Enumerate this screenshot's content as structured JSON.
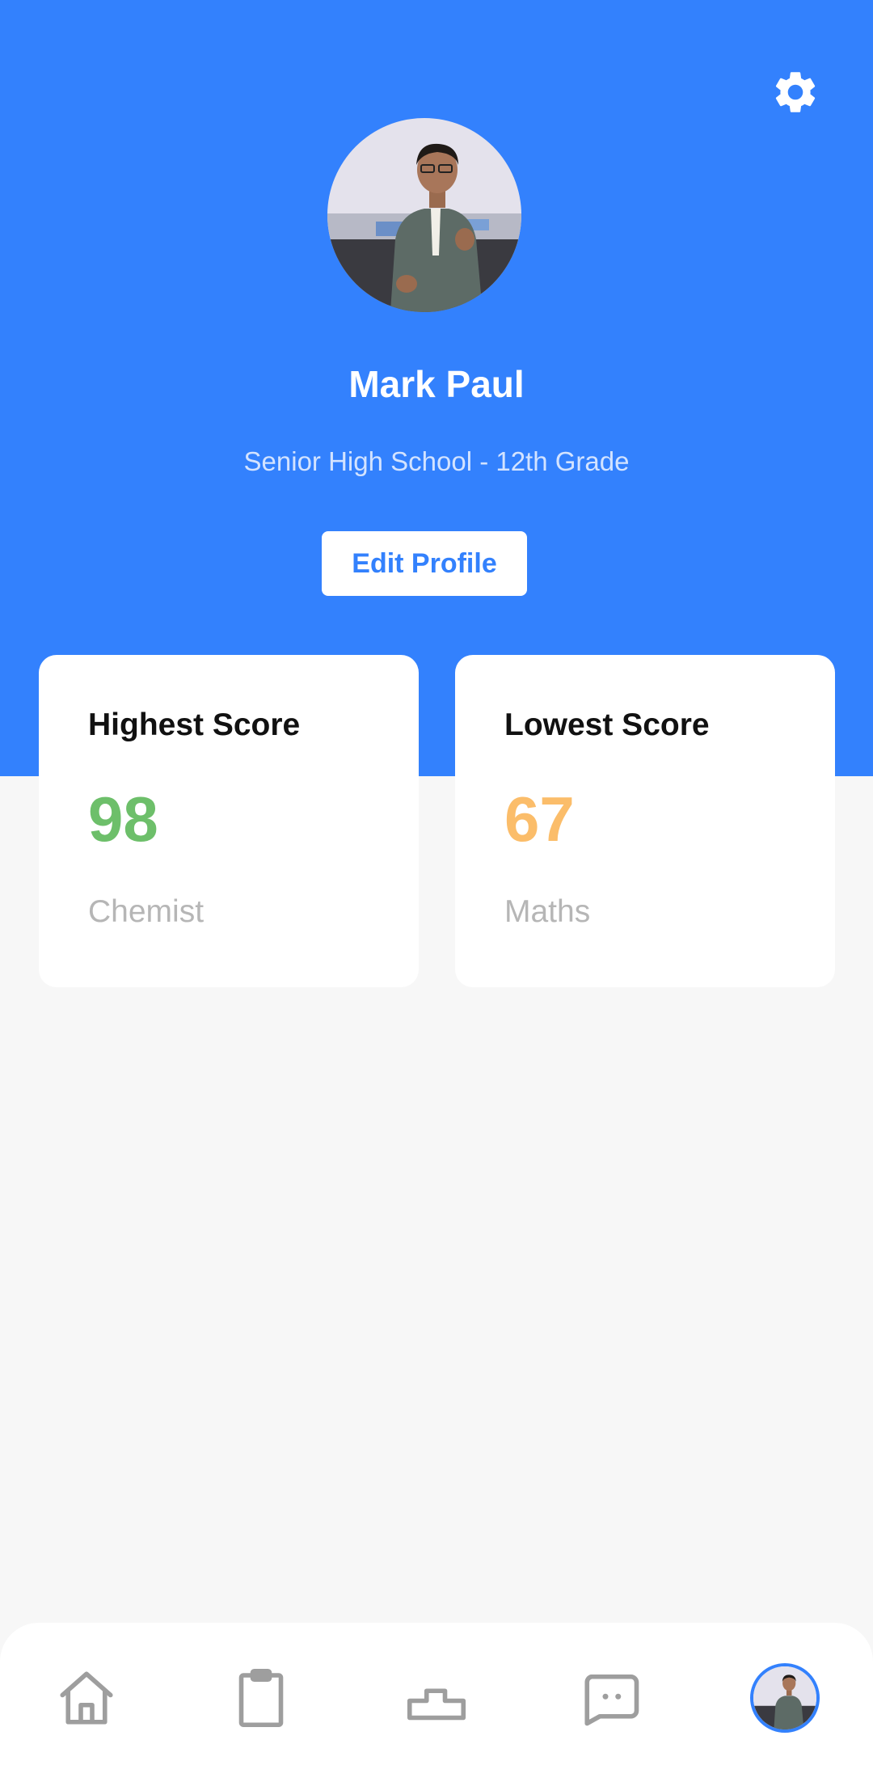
{
  "profile": {
    "name": "Mark Paul",
    "subtitle": "Senior High School - 12th Grade",
    "edit_label": "Edit Profile"
  },
  "cards": [
    {
      "title": "Highest Score",
      "value": "98",
      "subject": "Chemist",
      "color": "#6dbf6a"
    },
    {
      "title": "Lowest Score",
      "value": "67",
      "subject": "Maths",
      "color": "#fbbd6a"
    }
  ],
  "colors": {
    "primary": "#3381fd",
    "background": "#f7f7f7",
    "nav_icon": "#9e9e9e"
  },
  "icons": {
    "settings": "gear-icon",
    "nav": [
      "home-icon",
      "clipboard-icon",
      "podium-icon",
      "chat-icon",
      "profile-avatar"
    ]
  }
}
